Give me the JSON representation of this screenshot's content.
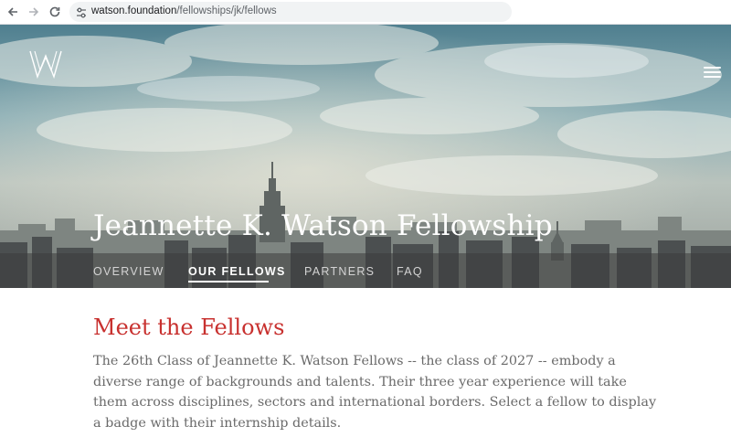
{
  "browser": {
    "url_host": "watson.foundation",
    "url_path": "/fellowships/jk/fellows",
    "back_icon": "arrow-left-icon",
    "forward_icon": "arrow-right-icon",
    "reload_icon": "reload-icon",
    "site_info_icon": "tune-icon"
  },
  "header": {
    "logo_letter": "W",
    "menu_icon": "hamburger-menu-icon",
    "title": "Jeannette K. Watson Fellowship"
  },
  "tabs": [
    {
      "label": "OVERVIEW",
      "active": false
    },
    {
      "label": "OUR FELLOWS",
      "active": true
    },
    {
      "label": "PARTNERS",
      "active": false
    },
    {
      "label": "FAQ",
      "active": false
    }
  ],
  "main": {
    "heading": "Meet the Fellows",
    "intro": "The 26th Class of Jeannette K. Watson Fellows -- the class of 2027 -- embody a diverse range of backgrounds and talents. Their three year experience will take them across disciplines, sectors and international borders. Select a fellow to display a badge with their internship details."
  },
  "colors": {
    "accent_red": "#c8312f",
    "body_text": "#6a6a6a",
    "hero_text": "#ffffff"
  }
}
